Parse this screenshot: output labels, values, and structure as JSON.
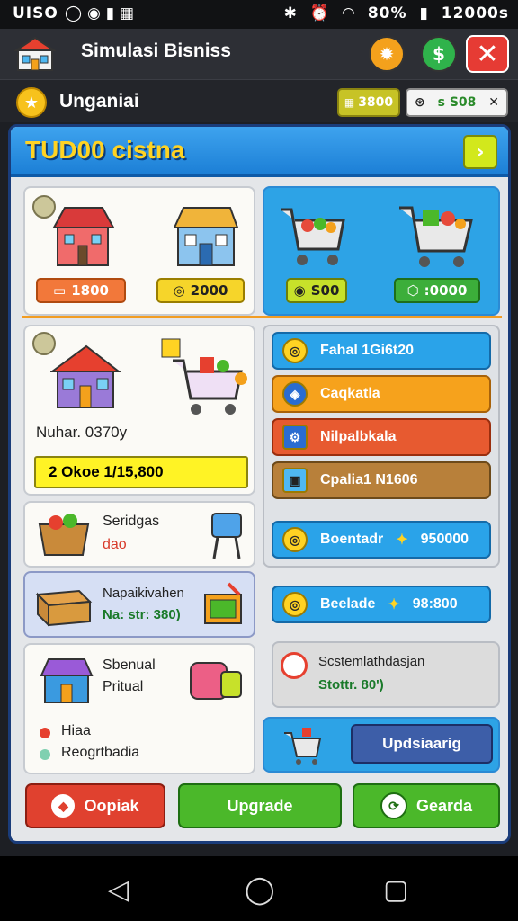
{
  "status": {
    "left": "UISO",
    "battery": "80%",
    "time": "12000s"
  },
  "title_bar": {
    "app_title": "Simulasi Bisniss"
  },
  "sub_bar": {
    "title": "Unganiai",
    "coins": "3800",
    "gems": "s S08"
  },
  "header": {
    "title": "TUD00 cistna"
  },
  "shop_buildings": {
    "left_price": "1800",
    "right_price": "2000"
  },
  "shop_carts": {
    "left_price": "S00",
    "right_price": ":0000"
  },
  "store_card": {
    "name": "Nuhar. 0370y",
    "stat": "2 Okoe 1/15,800"
  },
  "side_buttons": [
    {
      "label": "Fahal 1Gi6t20",
      "icon": "coin-icon"
    },
    {
      "label": "Caqkatla",
      "icon": "shield-icon"
    },
    {
      "label": "Nilpalbkala",
      "icon": "gear-icon"
    },
    {
      "label": "Cpalia1 N1606",
      "icon": "machine-icon"
    },
    {
      "label": "Boentadr",
      "value": "950000",
      "icon": "coin-icon"
    },
    {
      "label": "Beelade",
      "value": "98:800",
      "icon": "coin-icon"
    }
  ],
  "items": {
    "seridgas": {
      "title": "Seridgas",
      "sub": "dao"
    },
    "naprak": {
      "title": "Napaikivahen",
      "sub": "Na: str: 380)"
    },
    "sbenual": {
      "title": "Sbenual",
      "sub": "Pritual"
    }
  },
  "legend": {
    "a": "Hiaa",
    "b": "Reogrtbadia"
  },
  "system": {
    "title": "Scstemlathdasjan",
    "value": "Stottr. 80')"
  },
  "update_label": "Updsiaarig",
  "bottom": {
    "left": "Oopiak",
    "mid": "Upgrade",
    "right": "Gearda"
  },
  "colors": {
    "accent_yellow": "#ffd323",
    "blue": "#2da3e6",
    "green": "#4bb82a",
    "red": "#e0412f",
    "orange": "#f4a11c"
  }
}
